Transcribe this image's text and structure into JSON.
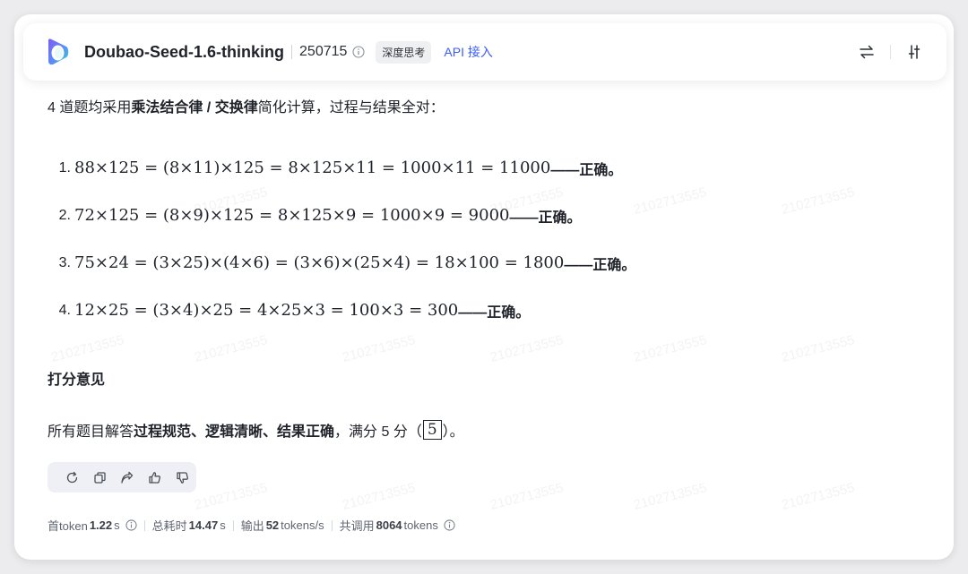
{
  "header": {
    "model_name": "Doubao-Seed-1.6-thinking",
    "version": "250715",
    "mode_badge": "深度思考",
    "api_link": "API 接入",
    "icons": [
      "swap-icon",
      "settings-sliders-icon",
      "info-icon"
    ]
  },
  "message": {
    "intro_prefix": "4 道题均采用",
    "intro_bold": "乘法结合律 / 交换律",
    "intro_suffix": "简化计算，过程与结果全对：",
    "equations": [
      {
        "num": "1.",
        "math": "88×125 = (8×11)×125 = 8×125×11 = 1000×11 = 11000",
        "verdict": "——正确。"
      },
      {
        "num": "2.",
        "math": "72×125 = (8×9)×125 = 8×125×9 = 1000×9 = 9000",
        "verdict": "——正确。"
      },
      {
        "num": "3.",
        "math": "75×24 = (3×25)×(4×6) = (3×6)×(25×4) = 18×100 = 1800",
        "verdict": "——正确。"
      },
      {
        "num": "4.",
        "math": "12×25 = (3×4)×25 = 4×25×3 = 100×3 = 300",
        "verdict": "——正确。"
      }
    ],
    "section_title": "打分意见",
    "summary_prefix": "所有题目解答",
    "summary_bold": "过程规范、逻辑清晰、结果正确",
    "summary_mid": "，满分 5 分（",
    "score": "5",
    "summary_suffix": "）。"
  },
  "toolbar_icons": [
    "regenerate-icon",
    "copy-icon",
    "share-icon",
    "thumbs-up-icon",
    "thumbs-down-icon"
  ],
  "stats": {
    "first_token_label": "首token",
    "first_token_value": "1.22",
    "first_token_unit": "s",
    "total_label": "总耗时",
    "total_value": "14.47",
    "total_unit": "s",
    "output_label": "输出",
    "output_value": "52",
    "output_unit": "tokens/s",
    "calls_label": "共调用",
    "calls_value": "8064",
    "calls_unit": "tokens"
  },
  "watermark": "2102713555",
  "colors": {
    "accent": "#3b5cf6",
    "logo_start": "#7b5cf5",
    "logo_end": "#34d3c4"
  }
}
